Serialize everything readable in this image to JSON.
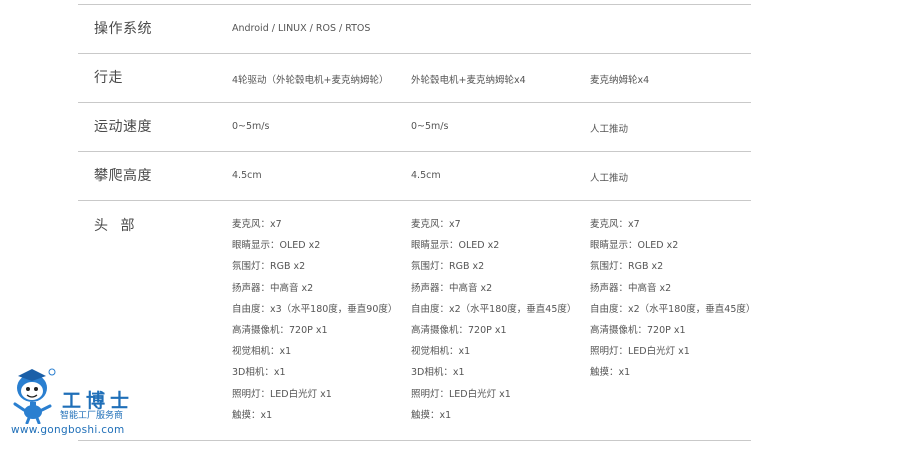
{
  "rows": [
    {
      "label": "操作系统",
      "cells": [
        "Android  /  LINUX  /  ROS  /  RTOS"
      ]
    },
    {
      "label": "行走",
      "cells": [
        "4轮驱动（外轮毂电机+麦克纳姆轮）",
        "外轮毂电机+麦克纳姆轮x4",
        "麦克纳姆轮x4"
      ]
    },
    {
      "label": "运动速度",
      "cells": [
        "0~5m/s",
        "0~5m/s",
        "人工推动"
      ]
    },
    {
      "label": "攀爬高度",
      "cells": [
        "4.5cm",
        "4.5cm",
        "人工推动"
      ]
    },
    {
      "label": "头  部",
      "col1": [
        "麦克风：x7",
        "眼睛显示：OLED  x2",
        "氛围灯：RGB  x2",
        "扬声器：中高音  x2",
        "自由度：x3（水平180度，垂直90度）",
        "高清摄像机：720P  x1",
        "视觉相机：x1",
        "3D相机：x1",
        "照明灯：LED白光灯  x1",
        "触摸：x1"
      ],
      "col2": [
        "麦克风：x7",
        "眼睛显示：OLED  x2",
        "氛围灯：RGB  x2",
        "扬声器：中高音  x2",
        "自由度：x2（水平180度，垂直45度）",
        "高清摄像机：720P  x1",
        "视觉相机：x1",
        "3D相机：x1",
        "照明灯：LED白光灯  x1",
        "触摸：x1"
      ],
      "col3": [
        "麦克风：x7",
        "眼睛显示：OLED  x2",
        "氛围灯：RGB  x2",
        "扬声器：中高音  x2",
        "自由度：x2（水平180度，垂直45度）",
        "高清摄像机：720P  x1",
        "照明灯：LED白光灯  x1",
        "触摸：x1"
      ]
    }
  ],
  "watermark": {
    "name": "工博士",
    "tagline": "智能工厂服务商",
    "url": "www.gongboshi.com",
    "color": "#1f6fb8"
  },
  "colors": {
    "divider": "#c9c9c9",
    "label": "#4a4a4a",
    "text": "#555555"
  }
}
